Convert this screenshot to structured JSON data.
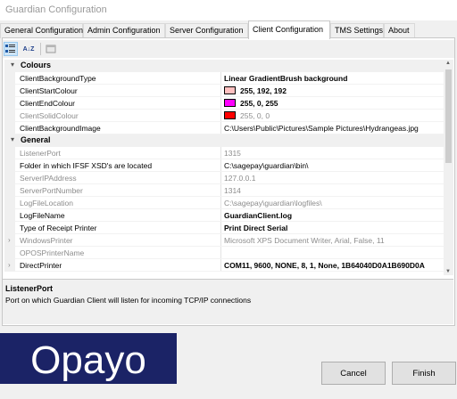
{
  "window": {
    "title": "Guardian Configuration"
  },
  "tabs": [
    {
      "label": "General Configuration"
    },
    {
      "label": "Admin Configuration"
    },
    {
      "label": "Server Configuration"
    },
    {
      "label": "Client Configuration"
    },
    {
      "label": "TMS Settings"
    },
    {
      "label": "About"
    }
  ],
  "toolbar": {
    "categorized_icon": "categorized-icon",
    "alphabetical_icon": "alphabetical-sort-icon",
    "alphabetical_glyph": "A↓Z",
    "pages_icon": "property-pages-icon"
  },
  "grid": {
    "colours": {
      "label": "Colours",
      "rows": [
        {
          "name": "ClientBackgroundType",
          "value": "Linear GradientBrush background"
        },
        {
          "name": "ClientStartColour",
          "value": "255, 192, 192",
          "color": "#ffc0c0"
        },
        {
          "name": "ClientEndColour",
          "value": "255, 0, 255",
          "color": "#ff00ff"
        },
        {
          "name": "ClientSolidColour",
          "value": "255, 0, 0",
          "color": "#ff0000"
        },
        {
          "name": "ClientBackgroundImage",
          "value": "C:\\Users\\Public\\Pictures\\Sample Pictures\\Hydrangeas.jpg"
        }
      ]
    },
    "general": {
      "label": "General",
      "rows": [
        {
          "name": "ListenerPort",
          "value": "1315"
        },
        {
          "name": "Folder in which IFSF XSD's are located",
          "value": "C:\\sagepay\\guardian\\bin\\"
        },
        {
          "name": "ServerIPAddress",
          "value": "127.0.0.1"
        },
        {
          "name": "ServerPortNumber",
          "value": "1314"
        },
        {
          "name": "LogFileLocation",
          "value": "C:\\sagepay\\guardian\\logfiles\\"
        },
        {
          "name": "LogFileName",
          "value": "GuardianClient.log"
        },
        {
          "name": "Type of Receipt Printer",
          "value": "Print Direct Serial"
        },
        {
          "name": "WindowsPrinter",
          "value": "Microsoft XPS Document Writer, Arial, False, 11"
        },
        {
          "name": "OPOSPrinterName",
          "value": ""
        },
        {
          "name": "DirectPrinter",
          "value": "COM11, 9600, NONE, 8, 1, None, 1B64040D0A1B690D0A"
        }
      ]
    }
  },
  "description": {
    "title": "ListenerPort",
    "text": "Port on which Guardian Client will listen for incoming TCP/IP connections"
  },
  "logo": {
    "text": "Opayo",
    "color": "#1b2366"
  },
  "buttons": {
    "cancel": "Cancel",
    "finish": "Finish"
  }
}
